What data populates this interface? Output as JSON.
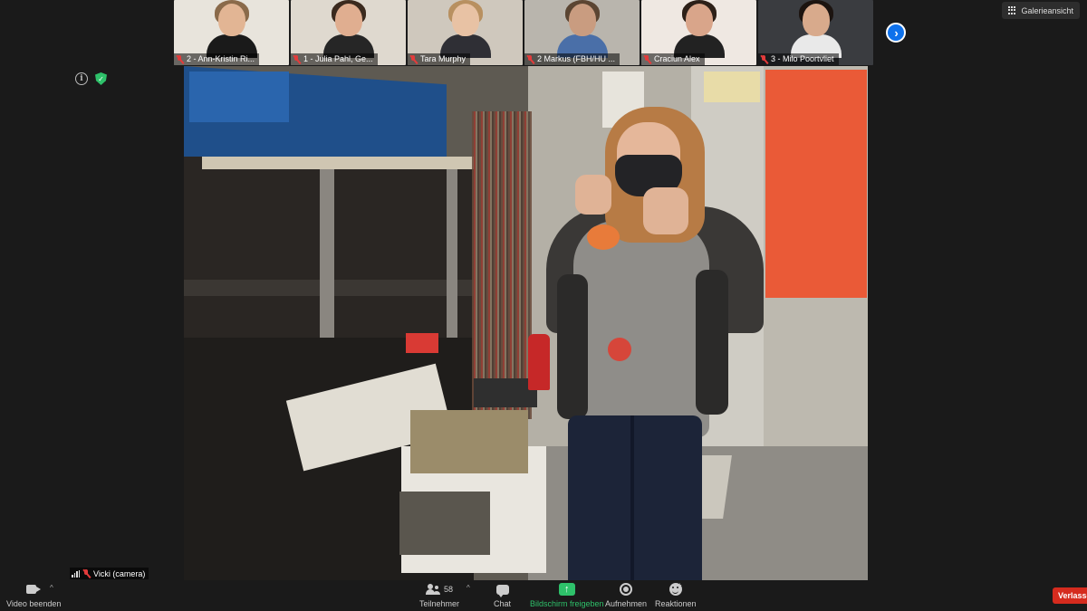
{
  "gallery": {
    "participants": [
      {
        "label": "2 - Ann-Kristin Ri...",
        "bg": "#e8e4dc",
        "skin": "#e2b594",
        "hair": "#8a6a4a",
        "shirt": "#1a1a1a"
      },
      {
        "label": "1 - Julia Pahl, Ge...",
        "bg": "#dfd9cf",
        "skin": "#e0ae90",
        "hair": "#3b2a1e",
        "shirt": "#262626"
      },
      {
        "label": "Tara Murphy",
        "bg": "#cfc8bd",
        "skin": "#e8c2a4",
        "hair": "#b89060",
        "shirt": "#2f2f35"
      },
      {
        "label": "2 Markus (FBH/HU ...",
        "bg": "#b9b5ad",
        "skin": "#c99c80",
        "hair": "#5b4532",
        "shirt": "#4a6fa8"
      },
      {
        "label": "Craciun Alex",
        "bg": "#efe8e2",
        "skin": "#d9a58a",
        "hair": "#2d2018",
        "shirt": "#222222"
      },
      {
        "label": "3 - Milo Poortvliet",
        "bg": "#3a3c40",
        "skin": "#d8aa8c",
        "hair": "#1c1410",
        "shirt": "#e9e9e9"
      }
    ],
    "next_label": "›"
  },
  "header": {
    "view_label": "Galerieansicht"
  },
  "main": {
    "speaker_label": "Vicki (camera)"
  },
  "toolbar": {
    "video": "Video beenden",
    "participants": "Teilnehmer",
    "participant_count": "58",
    "chat": "Chat",
    "share": "Bildschirm freigeben",
    "record": "Aufnehmen",
    "reactions": "Reaktionen",
    "leave": "Verlassen"
  },
  "colors": {
    "accent_blue": "#0e71eb",
    "share_green": "#2ec16a",
    "leave_red": "#d52b1e"
  }
}
